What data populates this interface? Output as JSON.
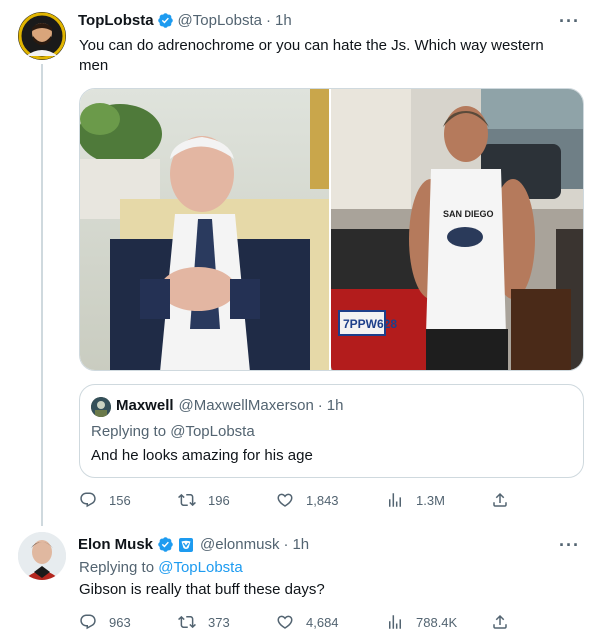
{
  "main_tweet": {
    "name": "TopLobsta",
    "handle": "@TopLobsta",
    "time": "1h",
    "separator": "·",
    "text": "You can do adrenochrome or you can hate the Js. Which way western men",
    "more": "···",
    "media": {
      "left_image": {
        "plate_text": ""
      },
      "right_image": {
        "shirt_text": "SAN DIEGO",
        "plate_text": "7PPW628"
      }
    },
    "quote": {
      "name": "Maxwell",
      "handle": "@MaxwellMaxerson",
      "time": "1h",
      "replying_prefix": "Replying to",
      "replying_to": "@TopLobsta",
      "text": "And he looks amazing for his age"
    },
    "stats": {
      "replies": "156",
      "retweets": "196",
      "likes": "1,843",
      "views": "1.3M"
    }
  },
  "reply_tweet": {
    "name": "Elon Musk",
    "handle": "@elonmusk",
    "time": "1h",
    "replying_prefix": "Replying to",
    "replying_to": "@TopLobsta",
    "text": "Gibson is really that buff these days?",
    "more": "···",
    "stats": {
      "replies": "963",
      "retweets": "373",
      "likes": "4,684",
      "views": "788.4K"
    }
  },
  "colors": {
    "verified": "#1d9bf0",
    "link": "#1d9bf0",
    "muted": "#536471",
    "border": "#cfd9de",
    "affiliate": "#1d9bf0"
  },
  "icons": [
    "reply-icon",
    "retweet-icon",
    "like-icon",
    "views-icon",
    "share-icon",
    "verified-badge-icon",
    "affiliate-badge-icon"
  ]
}
